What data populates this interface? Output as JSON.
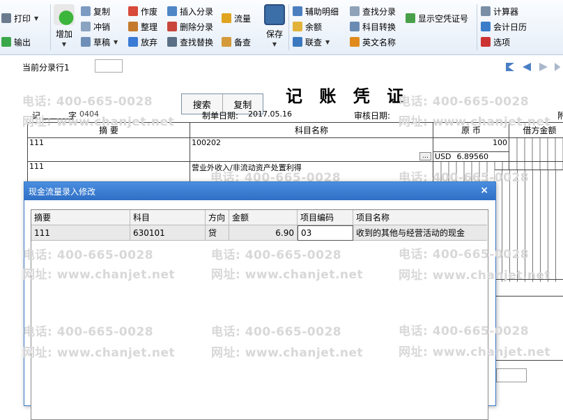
{
  "toolbar": {
    "print": "打印",
    "export": "输出",
    "add": "增加",
    "copy": "复制",
    "reverse": "冲销",
    "draft": "草稿",
    "void": "作废",
    "organize": "整理",
    "discard": "放弃",
    "insert_entry": "插入分录",
    "delete_entry": "删除分录",
    "find_replace": "查找替换",
    "cash_flow": "流量",
    "memo": "备查",
    "save": "保存",
    "aux_detail": "辅助明细",
    "balance": "余额",
    "linked_query": "联查",
    "find_entry": "查找分录",
    "subject_convert": "科目转换",
    "english_name": "英文名称",
    "show_empty_voucher": "显示空凭证号",
    "calculator": "计算器",
    "calendar": "会计日历",
    "options": "选项"
  },
  "watermark": {
    "phone": "电话: 400-665-0028",
    "site": "网址: www.chanjet.net"
  },
  "voucher": {
    "current_entry_label": "当前分录行1",
    "title": "记 账 凭 证",
    "search_button": "搜索",
    "copy_button": "复制",
    "type_label": "记",
    "number_label": "字",
    "number": "0404",
    "date_label": "制单日期:",
    "date": "2017.05.16",
    "review_label": "审核日期:",
    "attach_label": "附",
    "headers": {
      "summary": "摘 要",
      "subject": "科目名称",
      "currency": "原 币",
      "debit": "借方金额"
    },
    "rows": [
      {
        "summary": "111",
        "subject": "100202",
        "amount": "100",
        "currency_code": "USD",
        "rate": "6.89560"
      },
      {
        "summary": "111",
        "subject": "营业外收入/非流动资产处置利得",
        "amount": "",
        "currency_code": "",
        "rate": ""
      }
    ],
    "ellipsis": "..."
  },
  "dialog": {
    "title": "现金流量录入修改",
    "close": "×",
    "columns": [
      "摘要",
      "科目",
      "方向",
      "金额",
      "项目编码",
      "项目名称"
    ],
    "rows": [
      {
        "summary": "111",
        "subject": "630101",
        "direction": "贷",
        "amount": "6.90",
        "code": "03",
        "name": "收到的其他与经营活动的现金"
      }
    ]
  }
}
